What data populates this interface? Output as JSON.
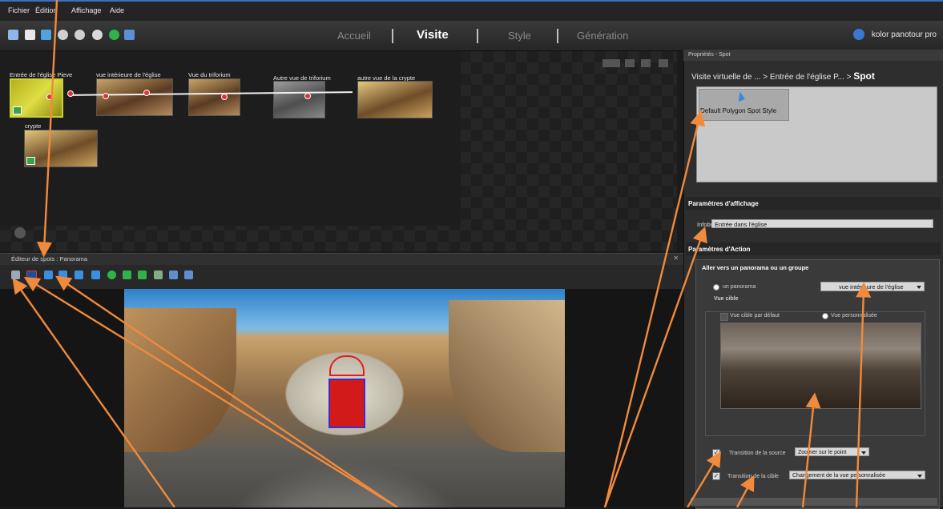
{
  "menu": [
    "Fichier",
    "Édition",
    "Affichage",
    "Aide"
  ],
  "tabs": [
    {
      "label": "Accueil",
      "active": false
    },
    {
      "label": "Visite",
      "active": true
    },
    {
      "label": "Style",
      "active": false
    },
    {
      "label": "Génération",
      "active": false
    }
  ],
  "brand": "kolor panotour pro",
  "tour": {
    "nodes": [
      {
        "label": "Entrée de l'église Pieve"
      },
      {
        "label": "vue intérieure de l'église"
      },
      {
        "label": "Vue du triforium"
      },
      {
        "label": "Autre vue de triforium"
      },
      {
        "label": "autre vue de la crypte"
      },
      {
        "label": "crypte"
      }
    ]
  },
  "spot_editor": {
    "title": "Éditeur de spots : Panorama"
  },
  "properties": {
    "header": "Propriétés - Spot",
    "breadcrumb_prefix": "Visite virtuelle de ... > Entrée de l'église P... > ",
    "breadcrumb_current": "Spot",
    "style_name": "Default Polygon Spot Style",
    "display_section": "Paramètres d'affichage",
    "tooltip_label": "Infobulle",
    "tooltip_value": "Entrée dans l'église",
    "action_section": "Paramètres d'Action",
    "action_title": "Aller vers un panorama ou un groupe",
    "radio_panorama": "un panorama",
    "panorama_selected": "vue intérieure de l'église",
    "target_view": "Vue cible",
    "default_view": "Vue cible par défaut",
    "custom_view": "Vue personnalisée",
    "source_transition_label": "Transition de la source",
    "source_transition_value": "Zoomer sur le point",
    "target_transition_label": "Transition de la cible",
    "target_transition_value": "Changement de la vue personnalisée"
  },
  "colors": {
    "accent": "#f08a3c",
    "link_blue": "#3b6fb8",
    "spot_red": "#d31a1a"
  }
}
